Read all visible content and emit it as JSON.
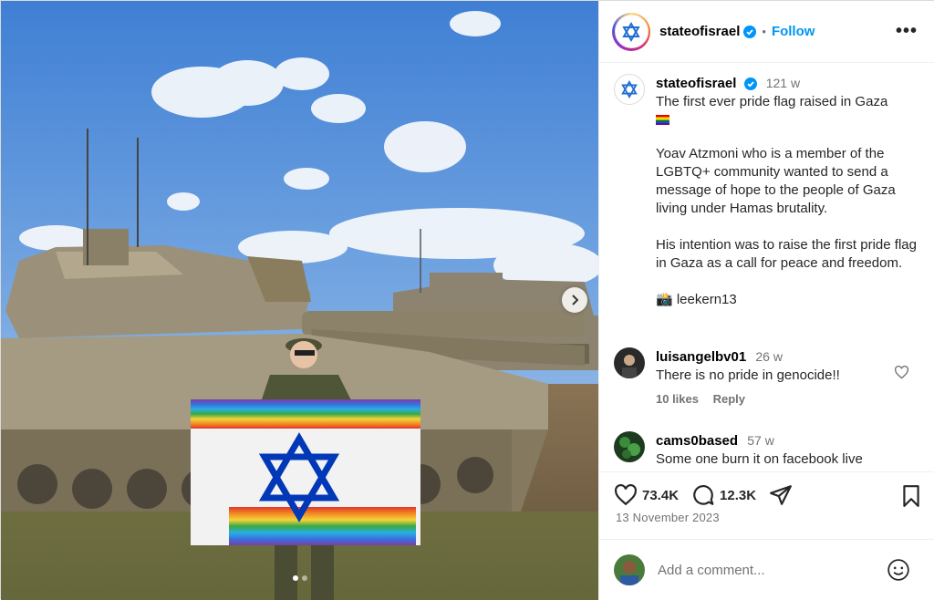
{
  "post": {
    "author": "stateofisrael",
    "follow_label": "Follow",
    "separator": "•",
    "more_label": "•••",
    "caption": {
      "author": "stateofisrael",
      "time": "121 w",
      "line1": "The first ever pride flag raised in Gaza",
      "emoji": "pride-flag-emoji",
      "paragraph2": "Yoav Atzmoni who is a member of the LGBTQ+ community wanted to send a message of hope to the people of Gaza living under Hamas brutality.",
      "paragraph3": "His intention was to raise the first pride flag in Gaza as a call for peace and freedom.",
      "credit": "📸 leekern13"
    },
    "comments": [
      {
        "author": "luisangelbv01",
        "time": "26 w",
        "text": "There is no pride in genocide!!",
        "likes": "10 likes",
        "reply": "Reply"
      },
      {
        "author": "cams0based",
        "time": "57 w",
        "text": "Some one burn it on facebook live"
      }
    ],
    "likes_count": "73.4K",
    "comments_count": "12.3K",
    "date": "13 November 2023",
    "add_comment_placeholder": "Add a comment...",
    "carousel": {
      "count": 2,
      "active": 0
    }
  },
  "colors": {
    "brand_blue": "#0095f6",
    "verified_blue": "#0095f6",
    "flag_blue": "#0038b8"
  }
}
